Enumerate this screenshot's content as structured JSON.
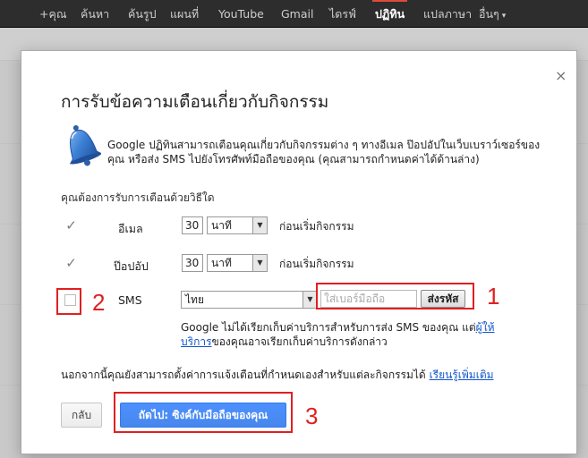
{
  "topbar": {
    "items": [
      "+คุณ",
      "ค้นหา",
      "ค้นรูป",
      "แผนที่",
      "YouTube",
      "Gmail",
      "ไดรฟ์",
      "ปฏิทิน",
      "แปลภาษา",
      "อื่นๆ"
    ],
    "active": "ปฏิทิน",
    "more_caret": "▾"
  },
  "dialog": {
    "close": "×",
    "title": "การรับข้อความเตือนเกี่ยวกับกิจกรรม",
    "intro": "Google ปฏิทินสามารถเตือนคุณเกี่ยวกับกิจกรรมต่าง ๆ ทางอีเมล ป๊อปอัปในเว็บเบราว์เซอร์ของคุณ หรือส่ง SMS ไปยังโทรศัพท์มือถือของคุณ (คุณสามารถกำหนดค่าได้ด้านล่าง)",
    "question": "คุณต้องการรับการเตือนด้วยวิธีใด",
    "rows": [
      {
        "label": "อีเมล",
        "checked": true,
        "number": "30",
        "unit": "นาที",
        "after": "ก่อนเริ่มกิจกรรม"
      },
      {
        "label": "ป๊อปอัป",
        "checked": true,
        "number": "30",
        "unit": "นาที",
        "after": "ก่อนเริ่มกิจกรรม"
      }
    ],
    "sms": {
      "label": "SMS",
      "checked": false,
      "country": "ไทย",
      "phone_placeholder": "ใส่เบอร์มือถือ",
      "send_code": "ส่งรหัส"
    },
    "notice": {
      "text_before": "Google ไม่ได้เรียกเก็บค่าบริการสำหรับการส่ง SMS ของคุณ แต่",
      "link": "ผู้ให้บริการ",
      "text_after": "ของคุณอาจเรียกเก็บค่าบริการดังกล่าว"
    },
    "footer": {
      "text": "นอกจากนี้คุณยังสามารถตั้งค่าการแจ้งเตือนที่กำหนดเองสำหรับแต่ละกิจกรรมได้",
      "link": "เรียนรู้เพิ่มเติม"
    },
    "buttons": {
      "back": "กลับ",
      "next": "ถัดไป: ซิงค์กับมือถือของคุณ"
    }
  },
  "annotations": [
    "1",
    "2",
    "3"
  ],
  "colors": {
    "topbar": "#2d2d2d",
    "primary_button": "#4d90fe",
    "link": "#1155cc",
    "annotation": "#e02020",
    "bell": "#3b7fd4"
  },
  "icons": {
    "checked": "check-icon",
    "bell": "bell-icon",
    "dropdown": "dropdown-arrow-icon",
    "close": "close-icon"
  }
}
